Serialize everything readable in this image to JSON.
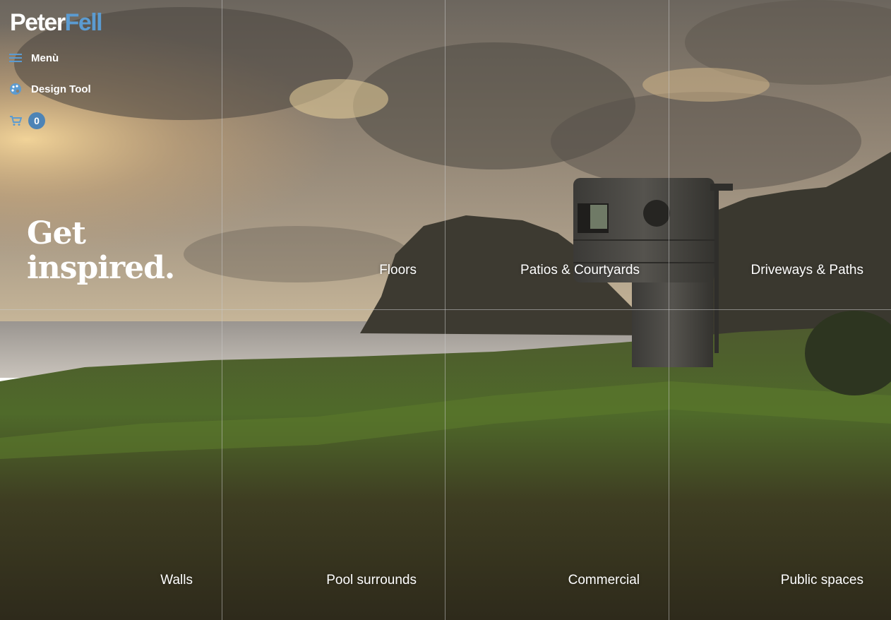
{
  "brand": {
    "part1": "Peter",
    "part2": "Fell"
  },
  "nav": {
    "menu_label": "Menù",
    "design_tool_label": "Design Tool",
    "cart_count": "0"
  },
  "hero": {
    "line1": "Get",
    "line2": "inspired."
  },
  "categories": {
    "floors": "Floors",
    "patios": "Patios & Courtyards",
    "driveways": "Driveways & Paths",
    "walls": "Walls",
    "pool": "Pool surrounds",
    "commercial": "Commercial",
    "public": "Public spaces"
  },
  "colors": {
    "brand_accent": "#5b9bd1",
    "badge": "#4d84b6"
  }
}
